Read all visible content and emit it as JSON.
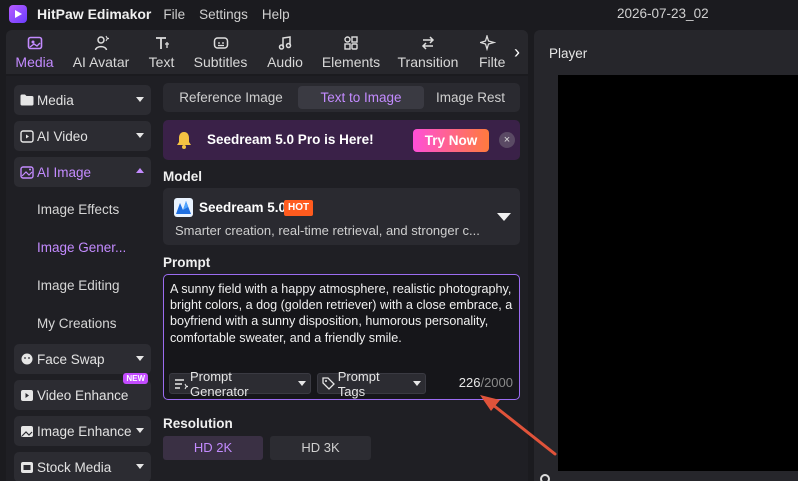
{
  "titlebar": {
    "app_name": "HitPaw Edimakor",
    "menus": [
      "File",
      "Settings",
      "Help"
    ],
    "project_name": "2026-07-23_02"
  },
  "toolbar": {
    "tools": [
      {
        "label": "Media",
        "icon": "media-icon",
        "active": true
      },
      {
        "label": "AI Avatar",
        "icon": "avatar-icon",
        "active": false
      },
      {
        "label": "Text",
        "icon": "text-icon",
        "active": false
      },
      {
        "label": "Subtitles",
        "icon": "subtitles-icon",
        "active": false
      },
      {
        "label": "Audio",
        "icon": "audio-icon",
        "active": false
      },
      {
        "label": "Elements",
        "icon": "elements-icon",
        "active": false
      },
      {
        "label": "Transition",
        "icon": "transition-icon",
        "active": false
      },
      {
        "label": "Filter",
        "icon": "filter-icon",
        "active": false
      }
    ]
  },
  "sidebar": {
    "categories": [
      {
        "label": "Media",
        "icon": "folder-icon"
      },
      {
        "label": "AI Video",
        "icon": "ai-video-icon"
      },
      {
        "label": "AI Image",
        "icon": "ai-image-icon",
        "active": true
      },
      {
        "label": "Face Swap",
        "icon": "face-swap-icon"
      },
      {
        "label": "Video Enhance",
        "icon": "video-enhance-icon",
        "badge": "NEW"
      },
      {
        "label": "Image Enhance",
        "icon": "image-enhance-icon"
      },
      {
        "label": "Stock Media",
        "icon": "stock-media-icon"
      }
    ],
    "subitems": [
      {
        "label": "Image Effects"
      },
      {
        "label": "Image Gener...",
        "active": true
      },
      {
        "label": "Image Editing"
      },
      {
        "label": "My Creations"
      }
    ]
  },
  "panel": {
    "tabs": [
      "Reference Image",
      "Text to Image",
      "Image Rest"
    ],
    "active_tab": "Text to Image",
    "promo": {
      "text": "Seedream 5.0 Pro is Here!",
      "button": "Try Now"
    },
    "model_label": "Model",
    "model": {
      "name": "Seedream 5.0",
      "badge": "HOT",
      "description": "Smarter creation, real-time retrieval, and stronger c..."
    },
    "prompt_label": "Prompt",
    "prompt_text": "A sunny field with a happy atmosphere, realistic photography, bright colors, a dog (golden retriever) with a close embrace, a boyfriend with a sunny disposition, humorous personality, comfortable sweater, and a friendly smile.",
    "prompt_generator": "Prompt Generator",
    "prompt_tags": "Prompt Tags",
    "char_count": "226",
    "char_max": "/2000",
    "resolution_label": "Resolution",
    "resolutions": [
      "HD 2K",
      "HD 3K"
    ]
  },
  "player": {
    "title": "Player"
  },
  "colors": {
    "accent": "#c38bff",
    "annotation_arrow": "#e0533a",
    "promo_gradient_start": "#ff4fd8",
    "hot_badge": "#ff5b1e"
  }
}
